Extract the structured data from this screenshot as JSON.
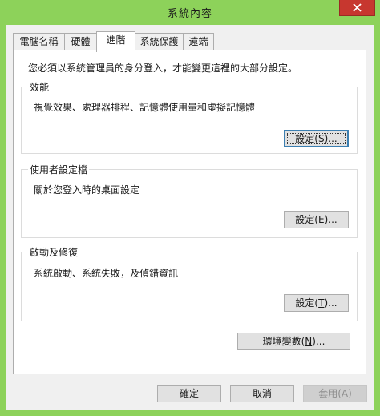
{
  "window": {
    "title": "系統內容",
    "close_icon": "close-icon"
  },
  "tabs": [
    {
      "label": "電腦名稱",
      "active": false
    },
    {
      "label": "硬體",
      "active": false
    },
    {
      "label": "進階",
      "active": true
    },
    {
      "label": "系統保護",
      "active": false
    },
    {
      "label": "遠端",
      "active": false
    }
  ],
  "advanced": {
    "intro": "您必須以系統管理員的身分登入，才能變更這裡的大部分設定。",
    "performance": {
      "title": "效能",
      "desc": "視覺效果、處理器排程、記憶體使用量和虛擬記憶體",
      "button": {
        "prefix": "設定(",
        "accel": "S",
        "suffix": ")..."
      }
    },
    "user_profiles": {
      "title": "使用者設定檔",
      "desc": "關於您登入時的桌面設定",
      "button": {
        "prefix": "設定(",
        "accel": "E",
        "suffix": ")..."
      }
    },
    "startup_recovery": {
      "title": "啟動及修復",
      "desc": "系統啟動、系統失敗，及偵錯資訊",
      "button": {
        "prefix": "設定(",
        "accel": "T",
        "suffix": ")..."
      }
    },
    "env_button": {
      "prefix": "環境變數(",
      "accel": "N",
      "suffix": ")..."
    }
  },
  "footer": {
    "ok": "確定",
    "cancel": "取消",
    "apply": {
      "prefix": "套用(",
      "accel": "A",
      "suffix": ")"
    }
  }
}
